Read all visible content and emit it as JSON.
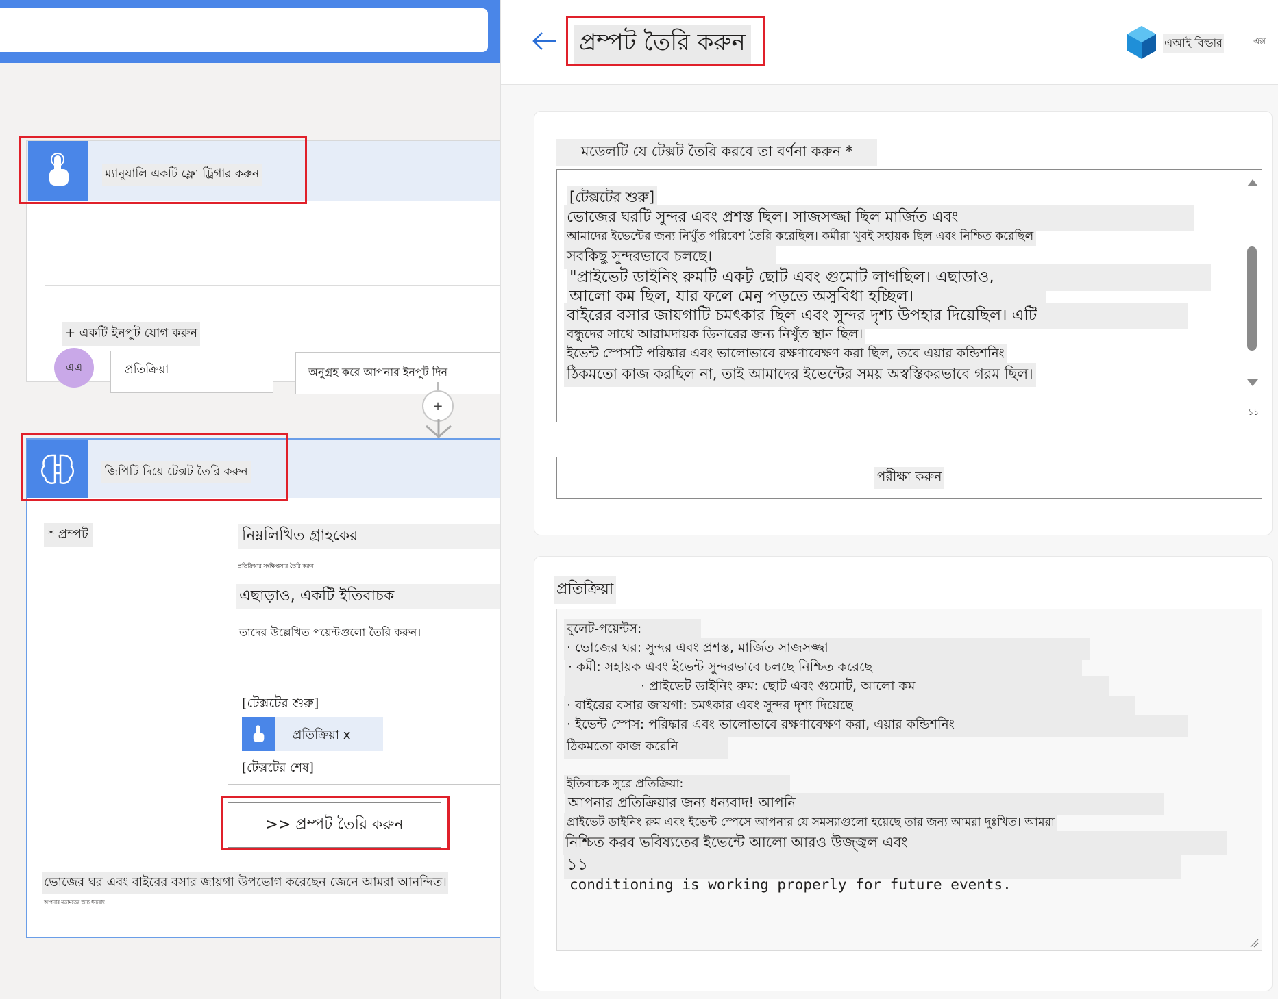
{
  "canvas": {
    "trigger": {
      "title": "ম্যানুয়ালি একটি ফ্লো ট্রিগার করুন",
      "avatar": "এএ",
      "input_name": "প্রতিক্রিয়া",
      "input_placeholder": "অনুগ্রহ করে আপনার ইনপুট দিন",
      "add_input": "+ একটি ইনপুট যোগ করুন"
    },
    "connector_plus": "+",
    "gpt": {
      "title": "জিপিটি দিয়ে টেক্সট তৈরি করুন",
      "prompt_label": "* প্রম্পট",
      "prompt_line1": "নিম্নলিখিত গ্রাহকের",
      "prompt_line2": "প্রতিক্রিয়ার সংক্ষিপ্তসার তৈরি করুন",
      "prompt_line3": "এছাড়াও, একটি ইতিবাচক",
      "prompt_line4": "তাদের উল্লেখিত পয়েন্টগুলো তৈরি করুন।",
      "text_start": "[টেক্সটের শুরু]",
      "chip_label": "প্রতিক্রিয়া x",
      "text_end": "[টেক্সটের শেষ]",
      "create_prompt_button": ">> প্রম্পট তৈরি করুন",
      "bottom_line1": "ভোজের ঘর এবং বাইরের বসার জায়গা উপভোগ করেছেন জেনে আমরা আনন্দিত।",
      "bottom_line2": "আপনার মতামতের জন্য ধন্যবাদ"
    }
  },
  "panel": {
    "title": "প্রম্পট তৈরি করুন",
    "brand_name": "এআই বিল্ডার",
    "brand_extra": "এক্স",
    "describe_label": "মডেলটি যে টেক্সট তৈরি করবে তা বর্ণনা করুন *",
    "textarea_lines": [
      "[টেক্সটের শুরু]",
      "ভোজের ঘরটি সুন্দর এবং প্রশস্ত ছিল। সাজসজ্জা ছিল মার্জিত এবং",
      "আমাদের ইভেন্টের জন্য নিখুঁত পরিবেশ তৈরি করেছিল। কর্মীরা খুবই সহায়ক ছিল এবং নিশ্চিত করেছিল",
      "সবকিছু সুন্দরভাবে চলছে।",
      "\"প্রাইভেট ডাইনিং রুমটি একটু ছোট এবং গুমোট লাগছিল। এছাড়াও,",
      "আলো কম ছিল, যার ফলে মেনু পড়তে অসুবিধা হচ্ছিল।",
      "বাইরের বসার জায়গাটি চমৎকার ছিল এবং সুন্দর দৃশ্য উপহার দিয়েছিল। এটি",
      "বন্ধুদের সাথে আরামদায়ক ডিনারের জন্য নিখুঁত স্থান ছিল।",
      "ইভেন্ট স্পেসটি পরিষ্কার এবং ভালোভাবে রক্ষণাবেক্ষণ করা ছিল, তবে এয়ার কন্ডিশনিং",
      "ঠিকমতো কাজ করছিল না, তাই আমাদের ইভেন্টের সময় অস্বস্তিকরভাবে গরম ছিল।"
    ],
    "char_count": "১১",
    "test_button": "পরীক্ষা করুন",
    "response_label": "প্রতিক্রিয়া",
    "response_lines": [
      "বুলেট-পয়েন্টস:",
      "· ভোজের ঘর: সুন্দর এবং প্রশস্ত, মার্জিত সাজসজ্জা",
      "· কর্মী: সহায়ক এবং ইভেন্ট সুন্দরভাবে চলছে নিশ্চিত করেছে",
      "· প্রাইভেট ডাইনিং রুম: ছোট এবং গুমোট, আলো কম",
      "· বাইরের বসার জায়গা: চমৎকার এবং সুন্দর দৃশ্য দিয়েছে",
      "· ইভেন্ট স্পেস: পরিষ্কার এবং ভালোভাবে রক্ষণাবেক্ষণ করা, এয়ার কন্ডিশনিং",
      "ঠিকমতো কাজ করেনি",
      "ইতিবাচক সুরে প্রতিক্রিয়া:",
      "আপনার প্রতিক্রিয়ার জন্য ধন্যবাদ! আপনি",
      "প্রাইভেট ডাইনিং রুম এবং ইভেন্ট স্পেসে আপনার যে সমস্যাগুলো হয়েছে তার জন্য আমরা দুঃখিত। আমরা",
      "নিশ্চিত করব ভবিষ্যতের ইভেন্টে আলো আরও উজ্জ্বল এবং",
      "১১",
      "conditioning is working properly for future events."
    ]
  }
}
